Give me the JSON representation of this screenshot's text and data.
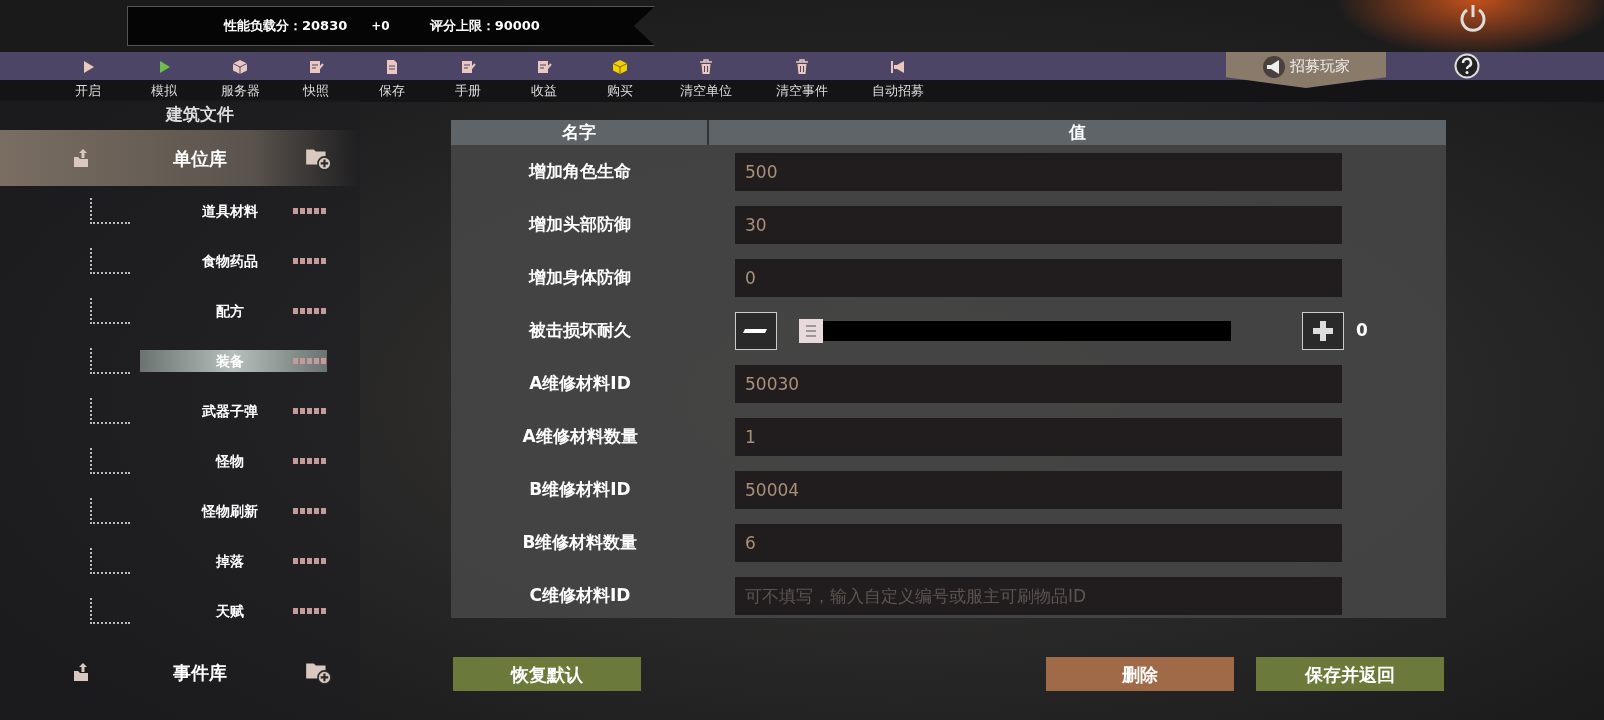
{
  "score_bar": {
    "load_label": "性能负载分：20830",
    "delta": "+0",
    "limit_label": "评分上限：90000"
  },
  "toolbar": [
    {
      "kind": "play",
      "label": "开启"
    },
    {
      "kind": "simulate",
      "label": "模拟"
    },
    {
      "kind": "server",
      "label": "服务器"
    },
    {
      "kind": "edit",
      "label": "快照"
    },
    {
      "kind": "doc",
      "label": "保存"
    },
    {
      "kind": "edit",
      "label": "手册"
    },
    {
      "kind": "edit",
      "label": "收益"
    },
    {
      "kind": "buy",
      "label": "购买"
    },
    {
      "kind": "trash",
      "label": "清空单位"
    },
    {
      "kind": "trash",
      "label": "清空事件"
    },
    {
      "kind": "auto",
      "label": "自动招募"
    }
  ],
  "recruit_button": "招募玩家",
  "sidebar": {
    "top_label": "建筑文件",
    "groups": [
      {
        "label": "单位库",
        "expanded": true,
        "children": [
          {
            "label": "道具材料",
            "selected": false
          },
          {
            "label": "食物药品",
            "selected": false
          },
          {
            "label": "配方",
            "selected": false
          },
          {
            "label": "装备",
            "selected": true
          },
          {
            "label": "武器子弹",
            "selected": false
          },
          {
            "label": "怪物",
            "selected": false
          },
          {
            "label": "怪物刷新",
            "selected": false
          },
          {
            "label": "掉落",
            "selected": false
          },
          {
            "label": "天赋",
            "selected": false
          }
        ]
      },
      {
        "label": "事件库",
        "expanded": false
      }
    ]
  },
  "table": {
    "columns": [
      "名字",
      "值"
    ],
    "rows": [
      {
        "kind": "field",
        "name": "增加角色生命",
        "value": "500"
      },
      {
        "kind": "field",
        "name": "增加头部防御",
        "value": "30"
      },
      {
        "kind": "field",
        "name": "增加身体防御",
        "value": "0"
      },
      {
        "kind": "slider",
        "name": "被击损坏耐久",
        "level": 0,
        "reading": "0"
      },
      {
        "kind": "field",
        "name": "A维修材料ID",
        "value": "50030"
      },
      {
        "kind": "field",
        "name": "A维修材料数量",
        "value": "1"
      },
      {
        "kind": "field",
        "name": "B维修材料ID",
        "value": "50004"
      },
      {
        "kind": "field",
        "name": "B维修材料数量",
        "value": "6"
      },
      {
        "kind": "field",
        "name": "C维修材料ID",
        "placeholder": "可不填写，输入自定义编号或服主可刷物品ID"
      }
    ]
  },
  "buttons": [
    {
      "kind": "restore",
      "label": "恢复默认"
    },
    {
      "kind": "delete",
      "label": "删除"
    },
    {
      "kind": "save",
      "label": "保存并返回"
    }
  ]
}
